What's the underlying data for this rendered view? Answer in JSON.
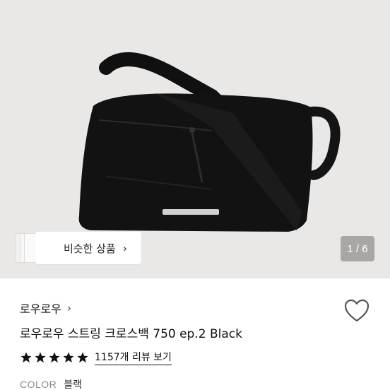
{
  "similar_button": {
    "label": "비슷한 상품",
    "chevron": "›"
  },
  "pager": {
    "text": "1 / 6"
  },
  "brand": {
    "name": "로우로우",
    "chevron": "›"
  },
  "product": {
    "title": "로우로우 스트링 크로스백 750 ep.2 Black",
    "rating": 5,
    "reviews_label": "1157개 리뷰 보기"
  },
  "color": {
    "label": "COLOR",
    "value": "블랙"
  },
  "icons": {
    "heart": "heart-icon",
    "star": "star-icon",
    "chevron": "chevron-right-icon"
  }
}
